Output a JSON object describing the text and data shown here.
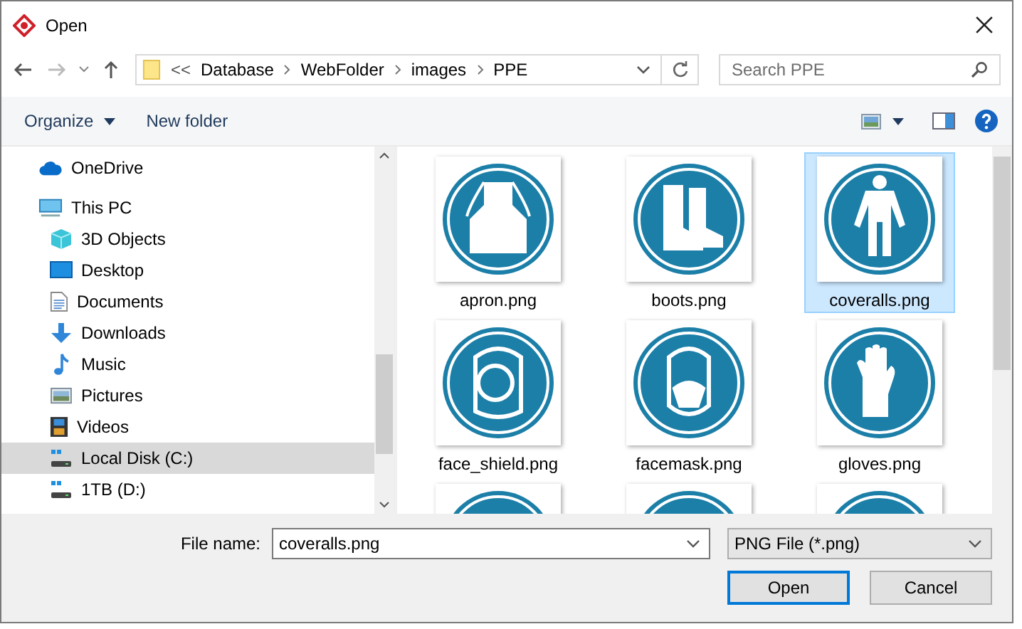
{
  "window": {
    "title": "Open"
  },
  "address": {
    "overflow": "<<",
    "crumbs": [
      "Database",
      "WebFolder",
      "images",
      "PPE"
    ]
  },
  "search": {
    "placeholder": "Search PPE"
  },
  "toolbar": {
    "organize": "Organize",
    "new_folder": "New folder"
  },
  "sidebar": {
    "items": [
      {
        "label": "OneDrive",
        "kind": "cloud",
        "selected": false
      },
      {
        "label": "This PC",
        "kind": "pc",
        "selected": false,
        "children": [
          {
            "label": "3D Objects",
            "kind": "cube",
            "selected": false
          },
          {
            "label": "Desktop",
            "kind": "desktop",
            "selected": false
          },
          {
            "label": "Documents",
            "kind": "document",
            "selected": false
          },
          {
            "label": "Downloads",
            "kind": "download",
            "selected": false
          },
          {
            "label": "Music",
            "kind": "music",
            "selected": false
          },
          {
            "label": "Pictures",
            "kind": "pictures",
            "selected": false
          },
          {
            "label": "Videos",
            "kind": "video",
            "selected": false
          },
          {
            "label": "Local Disk (C:)",
            "kind": "disk",
            "selected": true
          },
          {
            "label": "1TB (D:)",
            "kind": "disk",
            "selected": false
          }
        ]
      }
    ]
  },
  "files": [
    {
      "name": "apron.png",
      "kind": "apron",
      "selected": false
    },
    {
      "name": "boots.png",
      "kind": "boots",
      "selected": false
    },
    {
      "name": "coveralls.png",
      "kind": "coveralls",
      "selected": true
    },
    {
      "name": "face_shield.png",
      "kind": "face_shield",
      "selected": false
    },
    {
      "name": "facemask.png",
      "kind": "facemask",
      "selected": false
    },
    {
      "name": "gloves.png",
      "kind": "gloves",
      "selected": false
    }
  ],
  "footer": {
    "file_name_label": "File name:",
    "file_name": "coveralls.png",
    "file_type": "PNG File (*.png)",
    "open": "Open",
    "cancel": "Cancel"
  }
}
